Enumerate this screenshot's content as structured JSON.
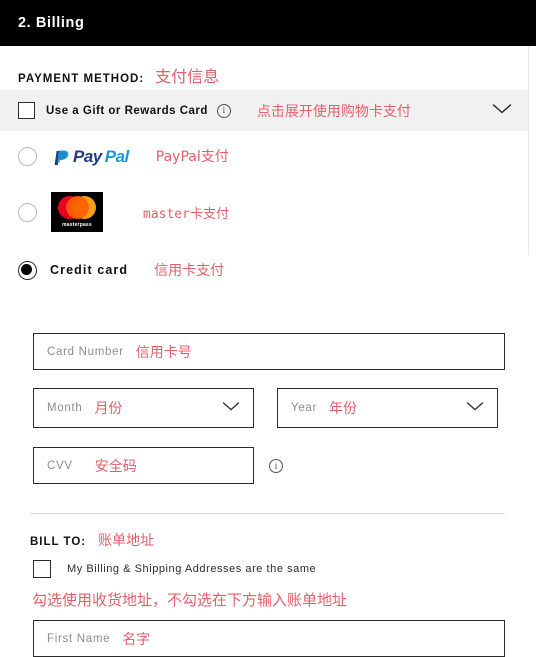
{
  "header": {
    "title": "2. Billing"
  },
  "payment_section": {
    "label": "PAYMENT METHOD:",
    "annotation": "支付信息"
  },
  "gift_card": {
    "label": "Use a Gift or Rewards Card",
    "info_icon": "info-icon",
    "annotation": "点击展开使用购物卡支付",
    "chevron": "chevron-down-icon",
    "checked": false
  },
  "payment_options": [
    {
      "id": "paypal",
      "logo_text_primary": "Pay",
      "logo_text_secondary": "Pal",
      "annotation": "PayPal支付",
      "selected": false
    },
    {
      "id": "masterpass",
      "logo_word": "masterpass",
      "annotation": "master卡支付",
      "selected": false
    },
    {
      "id": "credit-card",
      "label": "Credit card",
      "annotation": "信用卡支付",
      "selected": true
    }
  ],
  "card_form": {
    "card_number": {
      "placeholder": "Card Number",
      "annotation": "信用卡号",
      "value": ""
    },
    "month": {
      "placeholder": "Month",
      "annotation": "月份",
      "value": ""
    },
    "year": {
      "placeholder": "Year",
      "annotation": "年份",
      "value": ""
    },
    "cvv": {
      "placeholder": "CVV",
      "annotation": "安全码",
      "value": ""
    }
  },
  "bill_to": {
    "label": "BILL TO:",
    "annotation": "账单地址",
    "same_address_label": "My Billing & Shipping Addresses are the same",
    "same_address_checked": false,
    "same_address_annotation": "勾选使用收货地址，不勾选在下方输入账单地址",
    "first_name": {
      "placeholder": "First Name",
      "annotation": "名字",
      "value": ""
    }
  },
  "colors": {
    "header_bg": "#000000",
    "annotation_red": "#e05c66",
    "accordion_bg": "#f1f1f1",
    "border": "#2b2b2b",
    "paypal_dark": "#253b80",
    "paypal_light": "#179bd7",
    "mastercard_red": "#eb001b",
    "mastercard_yellow": "#f79e1b"
  }
}
